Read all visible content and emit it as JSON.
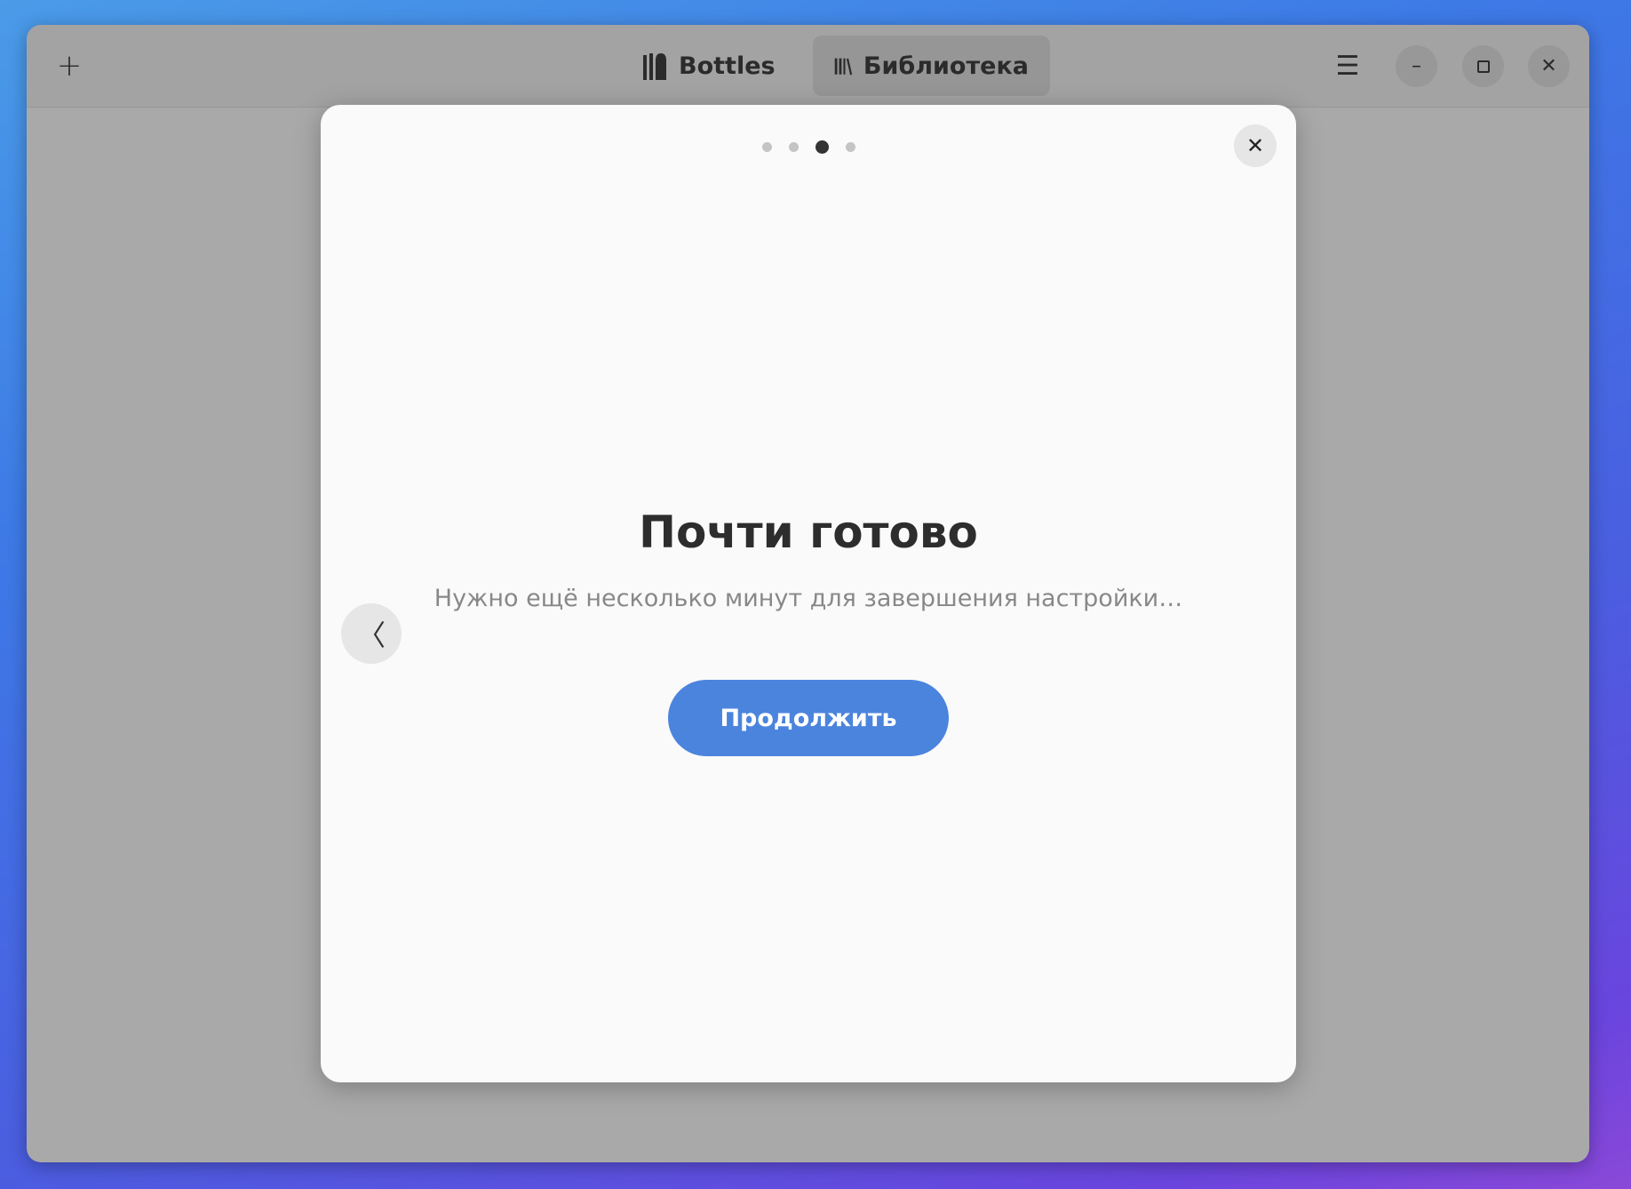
{
  "header": {
    "new_bottle_icon": "plus-icon",
    "tabs": [
      {
        "label": "Bottles",
        "icon": "bottles-icon",
        "active": false
      },
      {
        "label": "Библиотека",
        "icon": "library-icon",
        "active": true
      }
    ],
    "menu_icon": "hamburger-icon",
    "window_controls": [
      "minimize-icon",
      "maximize-icon",
      "close-icon"
    ]
  },
  "dialog": {
    "pages_total": 4,
    "current_page": 3,
    "title": "Почти готово",
    "subtitle": "Нужно ещё несколько минут для завершения настройки…",
    "continue_label": "Продолжить"
  },
  "colors": {
    "accent": "#4b84dd"
  }
}
